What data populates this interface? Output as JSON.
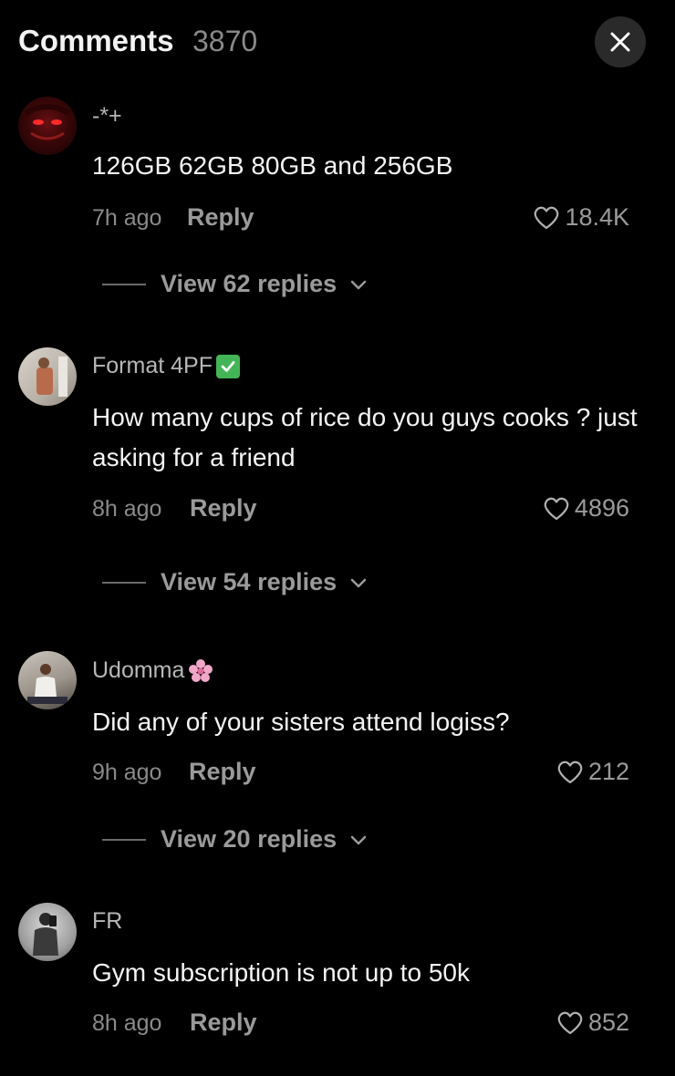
{
  "header": {
    "title": "Comments",
    "count": "3870"
  },
  "comments": [
    {
      "username": "-*+",
      "text": "126GB 62GB 80GB and 256GB",
      "time": "7h ago",
      "reply_label": "Reply",
      "likes": "18.4K",
      "view_replies": "View 62 replies",
      "avatar_icon": "red-eyed-character-avatar"
    },
    {
      "username": "Format 4PF",
      "username_badge_icon": "check-mark-button-emoji",
      "text": "How many cups of rice do you guys cooks ? just asking for a friend",
      "time": "8h ago",
      "reply_label": "Reply",
      "likes": "4896",
      "view_replies": "View 54 replies",
      "avatar_icon": "person-photo-avatar"
    },
    {
      "username": "Udomma",
      "username_badge_icon": "cherry-blossom-emoji",
      "text": "Did any of your sisters attend logiss?",
      "time": "9h ago",
      "reply_label": "Reply",
      "likes": "212",
      "view_replies": "View 20 replies",
      "avatar_icon": "person-seated-avatar"
    },
    {
      "username": "FR",
      "text": "Gym subscription is not up to 50k",
      "time": "8h ago",
      "reply_label": "Reply",
      "likes": "852",
      "avatar_icon": "mirror-selfie-avatar"
    }
  ],
  "colors": {
    "background": "#000000",
    "secondary_text": "#8a8a8a",
    "badge_green": "#44b556"
  }
}
